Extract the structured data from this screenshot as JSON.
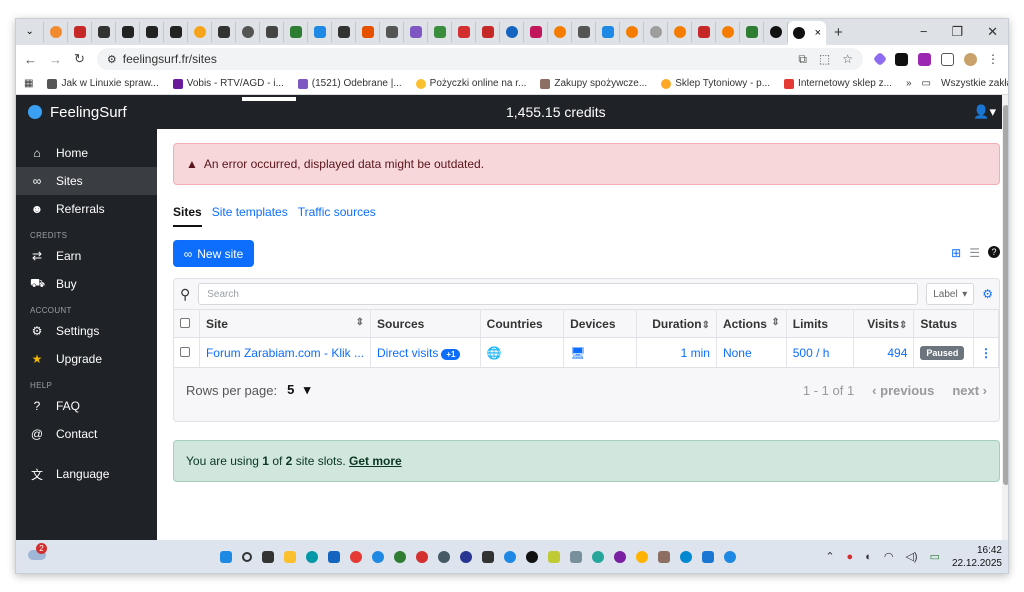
{
  "browser": {
    "url": "feelingsurf.fr/sites",
    "bookmarks": [
      "Jak w Linuxie spraw...",
      "Vobis - RTV/AGD - i...",
      "(1521) Odebrane |...",
      "Pożyczki online na r...",
      "Zakupy spożywcze...",
      "Sklep Tytoniowy - p...",
      "Internetowy sklep z..."
    ],
    "bookmarks_more": "»",
    "all_bookmarks": "Wszystkie zakładki"
  },
  "app": {
    "brand": "FeelingSurf",
    "credits": "1,455.15 credits"
  },
  "sidebar": {
    "items": [
      {
        "label": "Home"
      },
      {
        "label": "Sites"
      },
      {
        "label": "Referrals"
      }
    ],
    "credits_head": "CREDITS",
    "credits_items": [
      {
        "label": "Earn"
      },
      {
        "label": "Buy"
      }
    ],
    "account_head": "ACCOUNT",
    "account_items": [
      {
        "label": "Settings"
      },
      {
        "label": "Upgrade"
      }
    ],
    "help_head": "HELP",
    "help_items": [
      {
        "label": "FAQ"
      },
      {
        "label": "Contact"
      }
    ],
    "language": "Language"
  },
  "main": {
    "error": "An error occurred, displayed data might be outdated.",
    "tabs": [
      "Sites",
      "Site templates",
      "Traffic sources"
    ],
    "new_site": "New site",
    "search_placeholder": "Search",
    "label_select": "Label",
    "columns": [
      "Site",
      "Sources",
      "Countries",
      "Devices",
      "Duration",
      "Actions",
      "Limits",
      "Visits",
      "Status"
    ],
    "row": {
      "site": "Forum Zarabiam.com - Klik ...",
      "sources": "Direct visits",
      "sources_extra": "+1",
      "duration": "1 min",
      "actions": "None",
      "limits": "500 / h",
      "visits": "494",
      "status": "Paused"
    },
    "pager": {
      "rows_label": "Rows per page:",
      "rows_value": "5",
      "range": "1 - 1 of 1",
      "previous": "previous",
      "next": "next"
    },
    "slots_prefix": "You are using ",
    "slots_used": "1",
    "slots_mid": " of ",
    "slots_total": "2",
    "slots_suffix": " site slots. ",
    "get_more": "Get more"
  },
  "taskbar": {
    "notification_count": "2",
    "time": "16:42",
    "date": "22.12.2025"
  }
}
